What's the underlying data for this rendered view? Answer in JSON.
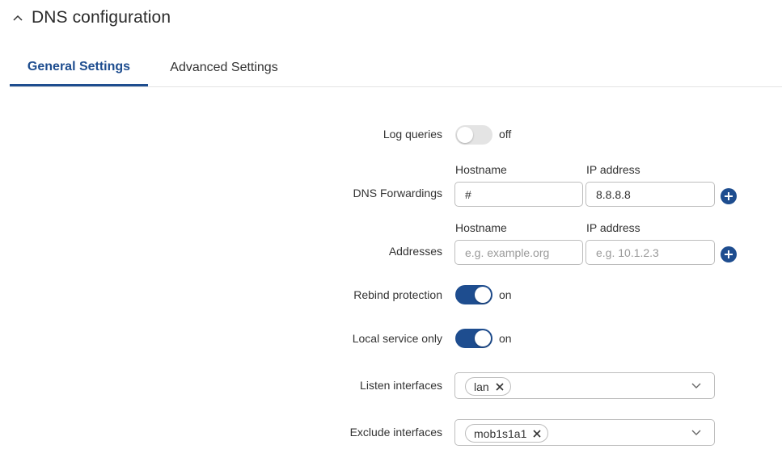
{
  "section": {
    "title": "DNS configuration"
  },
  "tabs": [
    {
      "label": "General Settings",
      "active": true
    },
    {
      "label": "Advanced Settings",
      "active": false
    }
  ],
  "form": {
    "log_queries": {
      "label": "Log queries",
      "state": "off"
    },
    "dns_forwardings": {
      "label": "DNS Forwardings",
      "hostname_label": "Hostname",
      "ip_label": "IP address",
      "hostname_value": "#",
      "ip_value": "8.8.8.8"
    },
    "addresses": {
      "label": "Addresses",
      "hostname_label": "Hostname",
      "ip_label": "IP address",
      "hostname_placeholder": "e.g. example.org",
      "ip_placeholder": "e.g. 10.1.2.3"
    },
    "rebind_protection": {
      "label": "Rebind protection",
      "state": "on"
    },
    "local_service_only": {
      "label": "Local service only",
      "state": "on"
    },
    "listen_interfaces": {
      "label": "Listen interfaces",
      "chips": [
        "lan"
      ]
    },
    "exclude_interfaces": {
      "label": "Exclude interfaces",
      "chips": [
        "mob1s1a1"
      ]
    }
  },
  "colors": {
    "accent": "#1e4d8f",
    "toggle_off": "#e4e4e4",
    "border": "#bdbdbd"
  },
  "icons": {
    "collapse": "chevron-up-icon",
    "add": "plus-circle-icon",
    "remove": "close-icon",
    "dropdown": "chevron-down-icon"
  }
}
